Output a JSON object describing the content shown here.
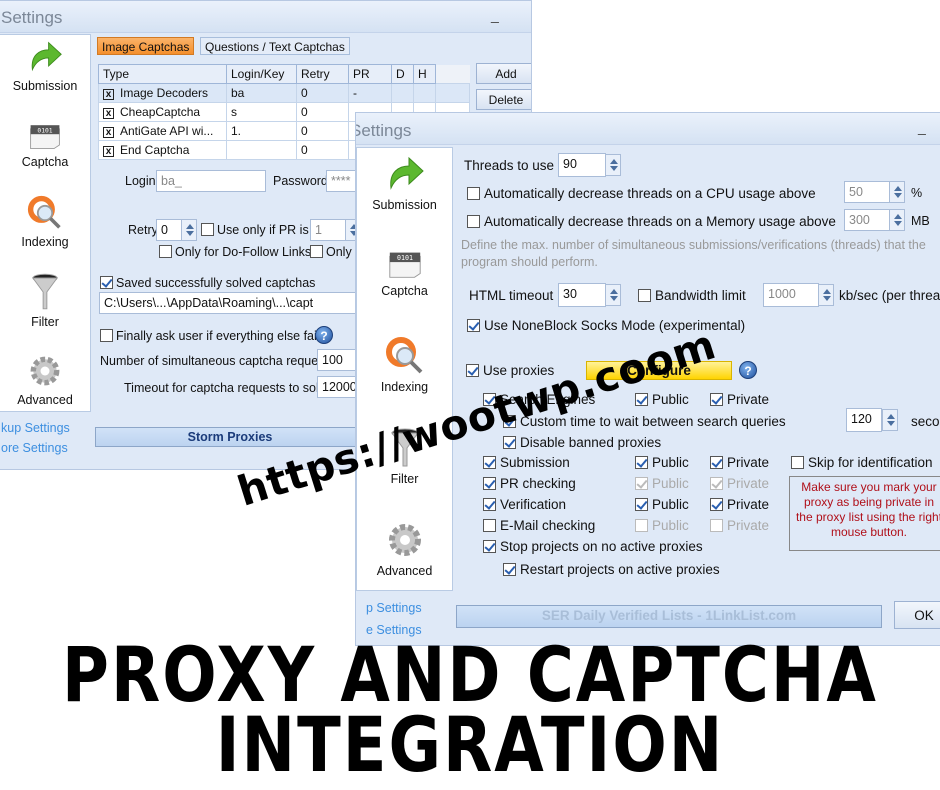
{
  "window1": {
    "title": "Settings",
    "minimize": "_",
    "sidebar": [
      {
        "label": "Submission",
        "icon": "submission-arrow-icon"
      },
      {
        "label": "Captcha",
        "icon": "captcha-icon"
      },
      {
        "label": "Indexing",
        "icon": "indexing-icon"
      },
      {
        "label": "Filter",
        "icon": "filter-funnel-icon"
      },
      {
        "label": "Advanced",
        "icon": "gear-icon"
      }
    ],
    "links": [
      "kup Settings",
      "ore Settings"
    ],
    "tabs": [
      "Image Captchas",
      "Questions / Text Captchas"
    ],
    "table": {
      "columns": [
        "Type",
        "Login/Key",
        "Retry",
        "PR",
        "D",
        "H"
      ],
      "rows": [
        {
          "type": "Image Decoders",
          "login": "ba",
          "retry": "0",
          "pr": "-"
        },
        {
          "type": "CheapCaptcha",
          "login": "s",
          "retry": "0",
          "pr": ""
        },
        {
          "type": "AntiGate API wi...",
          "login": "1.",
          "retry": "0",
          "pr": ""
        },
        {
          "type": "End Captcha",
          "login": "",
          "retry": "0",
          "pr": ""
        }
      ]
    },
    "buttons": {
      "add": "Add",
      "delete": "Delete"
    },
    "login_label": "Login",
    "login_value": "ba_",
    "password_label": "Password",
    "password_value": "****",
    "retry_label": "Retry",
    "retry_value": "0",
    "use_only_pr_label": "Use only if PR is",
    "pr_value": "1",
    "dofollow_label": "Only for Do-Follow Links",
    "only_fo_label": "Only fo",
    "saved_label": "Saved successfully solved captchas",
    "saved_path": "C:\\Users\\...\\AppData\\Roaming\\...\\capt",
    "finally_ask_label": "Finally ask user if everything else fails",
    "simultaneous_label": "Number of simultaneous captcha requests",
    "simultaneous_value": "100",
    "timeout_label": "Timeout for captcha requests to solve",
    "timeout_value": "12000",
    "storm_proxies": "Storm Proxies"
  },
  "window2": {
    "title": "Settings",
    "minimize": "_",
    "sidebar": [
      {
        "label": "Submission",
        "icon": "submission-arrow-icon"
      },
      {
        "label": "Captcha",
        "icon": "captcha-icon"
      },
      {
        "label": "Indexing",
        "icon": "indexing-icon"
      },
      {
        "label": "Filter",
        "icon": "filter-funnel-icon"
      },
      {
        "label": "Advanced",
        "icon": "gear-icon"
      }
    ],
    "links": [
      "p Settings",
      "e Settings"
    ],
    "threads_label": "Threads to use",
    "threads_value": "90",
    "cpu_label": "Automatically decrease threads on a CPU usage above",
    "cpu_value": "50",
    "cpu_unit": "%",
    "mem_label": "Automatically decrease threads on a Memory usage above",
    "mem_value": "300",
    "mem_unit": "MB",
    "description": "Define the max. number of simultaneous submissions/verifications (threads) that the program should perform.",
    "html_timeout_label": "HTML timeout",
    "html_timeout_value": "30",
    "bandwidth_label": "Bandwidth limit",
    "bandwidth_value": "1000",
    "bandwidth_unit": "kb/sec (per threa",
    "noneblock_label": "Use NoneBlock Socks Mode (experimental)",
    "use_proxies_label": "Use proxies",
    "configure": "Configure",
    "help": "?",
    "public": "Public",
    "private": "Private",
    "proxy_rows": [
      {
        "label": "Search Engines",
        "checked": true,
        "public": true,
        "private": true,
        "disabled": false
      },
      {
        "label": "Submission",
        "checked": true,
        "public": true,
        "private": true,
        "disabled": false
      },
      {
        "label": "PR checking",
        "checked": true,
        "public": true,
        "private": true,
        "disabled": true
      },
      {
        "label": "Verification",
        "checked": true,
        "public": true,
        "private": true,
        "disabled": false
      },
      {
        "label": "E-Mail checking",
        "checked": false,
        "public": false,
        "private": false,
        "disabled": true
      }
    ],
    "custom_wait_label": "Custom time to wait between search queries",
    "custom_wait_value": "120",
    "custom_wait_unit": "seco",
    "disable_banned_label": "Disable banned proxies",
    "skip_label": "Skip for identification",
    "note": "Make sure you mark your proxy as being private in the proxy list using the right mouse button.",
    "stop_label": "Stop projects on no active proxies",
    "restart_label": "Restart projects on active proxies",
    "bottom_bar": "SER Daily Verified Lists - 1LinkList.com",
    "ok": "OK"
  },
  "watermark": "https://wootwp.coom",
  "headline": [
    "PROXY AND CAPTCHA",
    "INTEGRATION"
  ],
  "colors": {
    "active_tab": "#f48f2c",
    "configure": "#ffd400",
    "note_text": "#b0101a",
    "link": "#3d8fe0"
  }
}
